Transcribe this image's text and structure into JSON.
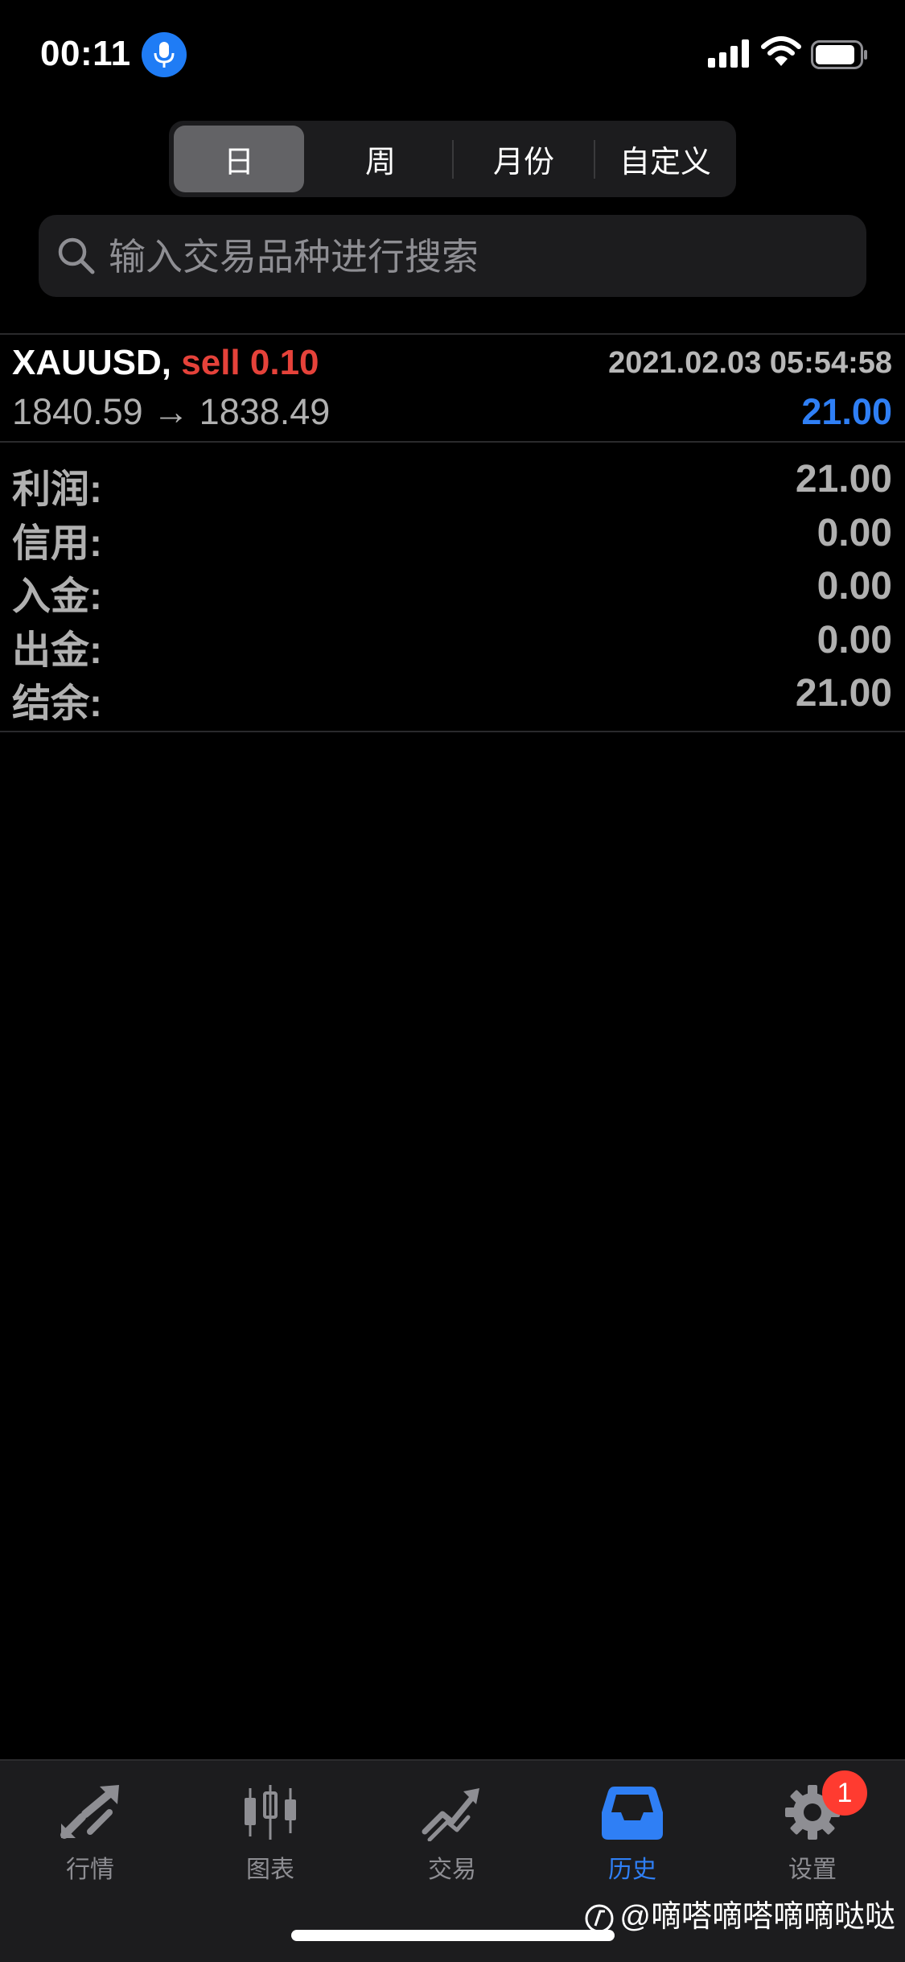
{
  "status_bar": {
    "time": "00:11"
  },
  "period_tabs": [
    {
      "label": "日",
      "active": true
    },
    {
      "label": "周",
      "active": false
    },
    {
      "label": "月份",
      "active": false
    },
    {
      "label": "自定义",
      "active": false
    }
  ],
  "search": {
    "placeholder": "输入交易品种进行搜索",
    "value": ""
  },
  "deal": {
    "symbol": "XAUUSD,",
    "side": "sell 0.10",
    "time": "2021.02.03 05:54:58",
    "prices": "1840.59 → 1838.49",
    "profit": "21.00",
    "profit_color": "#2f7ff5",
    "side_color": "#e5423a"
  },
  "summary": [
    {
      "label": "利润:",
      "value": "21.00"
    },
    {
      "label": "信用:",
      "value": "0.00"
    },
    {
      "label": "入金:",
      "value": "0.00"
    },
    {
      "label": "出金:",
      "value": "0.00"
    },
    {
      "label": "结余:",
      "value": "21.00"
    }
  ],
  "tab_bar": [
    {
      "label": "行情",
      "icon": "quotes-arrows-icon",
      "active": false
    },
    {
      "label": "图表",
      "icon": "candlestick-chart-icon",
      "active": false
    },
    {
      "label": "交易",
      "icon": "trade-trend-icon",
      "active": false
    },
    {
      "label": "历史",
      "icon": "history-inbox-icon",
      "active": true
    },
    {
      "label": "设置",
      "icon": "gear-icon",
      "active": false,
      "badge": "1"
    }
  ],
  "watermark": "@嘀嗒嘀嗒嘀嘀哒哒",
  "colors": {
    "accent": "#2f7ff5",
    "sell": "#e5423a",
    "badge": "#ff3b30"
  }
}
